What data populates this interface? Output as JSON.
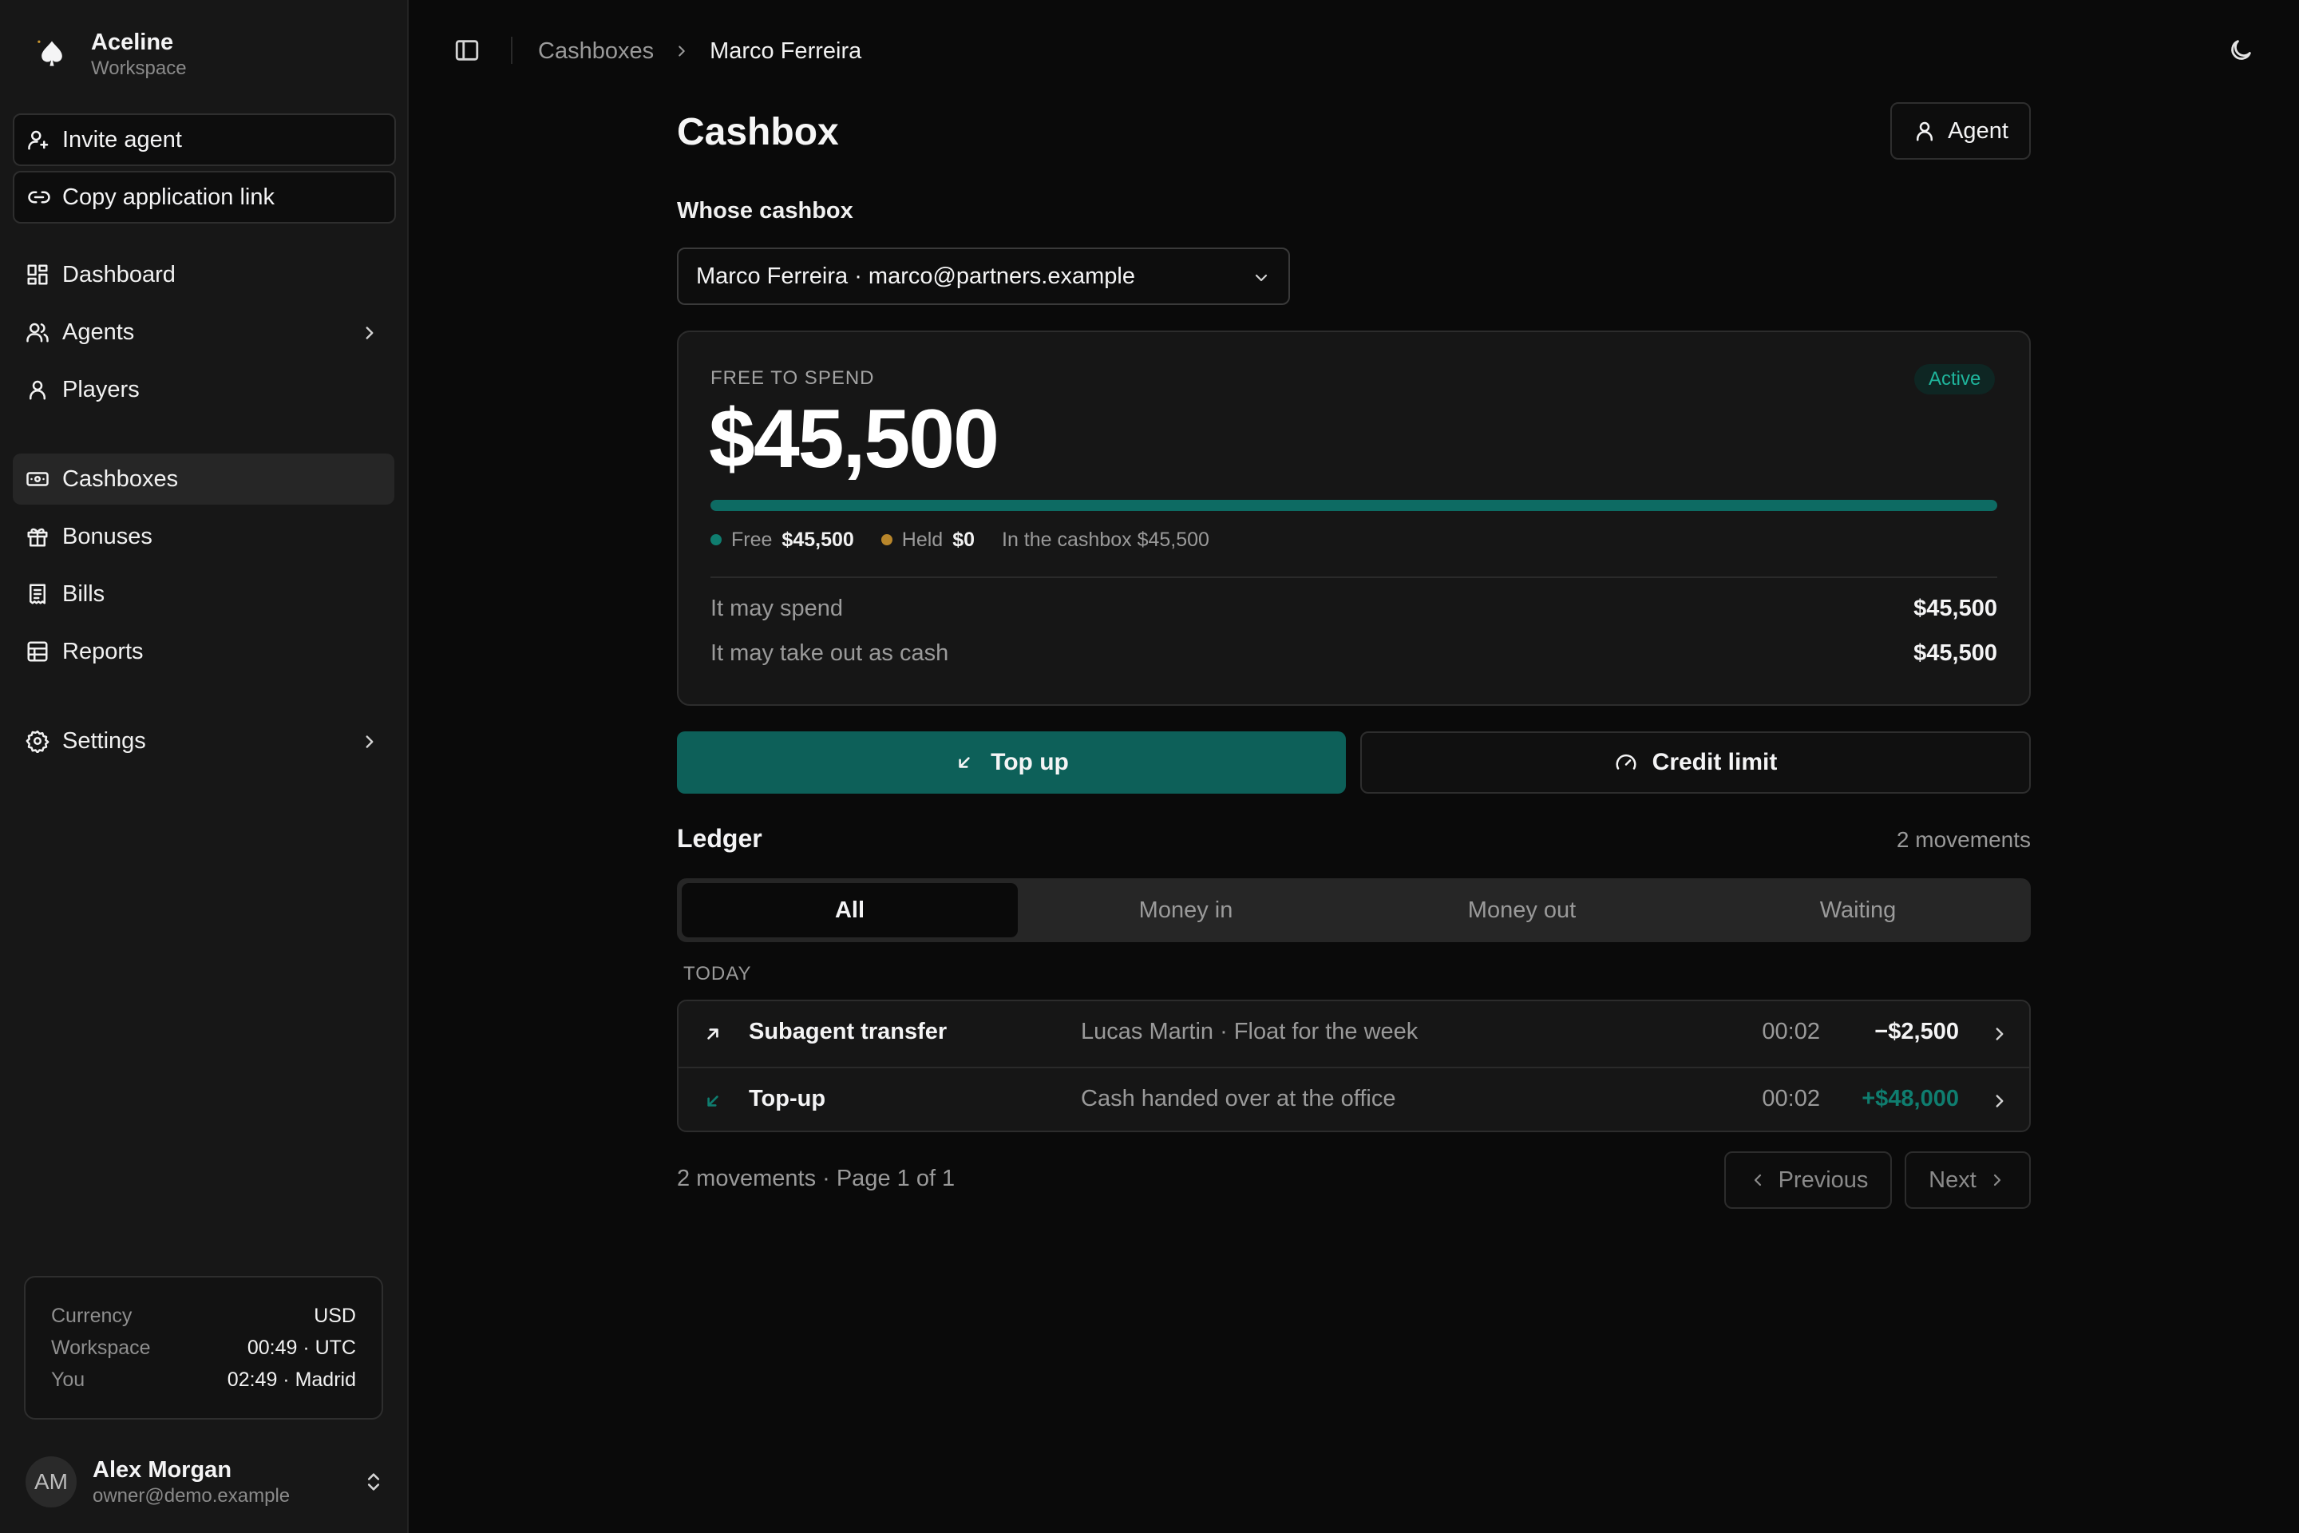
{
  "brand": {
    "name": "Aceline",
    "subtitle": "Workspace"
  },
  "sidebar": {
    "actions": [
      {
        "label": "Invite agent",
        "icon": "user-plus-icon"
      },
      {
        "label": "Copy application link",
        "icon": "link-icon"
      }
    ],
    "nav": [
      {
        "label": "Dashboard",
        "icon": "dashboard-icon",
        "chevron": false,
        "active": false
      },
      {
        "label": "Agents",
        "icon": "users-icon",
        "chevron": true,
        "active": false
      },
      {
        "label": "Players",
        "icon": "user-icon",
        "chevron": false,
        "active": false
      },
      {
        "label": "Cashboxes",
        "icon": "banknote-icon",
        "chevron": false,
        "active": true
      },
      {
        "label": "Bonuses",
        "icon": "gift-icon",
        "chevron": false,
        "active": false
      },
      {
        "label": "Bills",
        "icon": "receipt-icon",
        "chevron": false,
        "active": false
      },
      {
        "label": "Reports",
        "icon": "table-icon",
        "chevron": false,
        "active": false
      },
      {
        "label": "Settings",
        "icon": "gear-icon",
        "chevron": true,
        "active": false
      }
    ],
    "info": {
      "currency_label": "Currency",
      "currency_value": "USD",
      "workspace_label": "Workspace",
      "workspace_value": "00:49 · UTC",
      "you_label": "You",
      "you_value": "02:49 · Madrid"
    },
    "user": {
      "initials": "AM",
      "name": "Alex Morgan",
      "email": "owner@demo.example"
    }
  },
  "breadcrumb": {
    "parent": "Cashboxes",
    "current": "Marco Ferreira"
  },
  "page": {
    "title": "Cashbox",
    "agent_button": "Agent",
    "whose_label": "Whose cashbox",
    "whose_value": "Marco Ferreira · marco@partners.example"
  },
  "balance": {
    "label": "FREE TO SPEND",
    "status": "Active",
    "amount": "$45,500",
    "free_fraction": 1.0,
    "legend": {
      "free_label": "Free",
      "free_value": "$45,500",
      "held_label": "Held",
      "held_value": "$0",
      "total": "In the cashbox $45,500"
    },
    "rows": [
      {
        "label": "It may spend",
        "value": "$45,500"
      },
      {
        "label": "It may take out as cash",
        "value": "$45,500"
      }
    ]
  },
  "buttons": {
    "top_up": "Top up",
    "credit_limit": "Credit limit"
  },
  "ledger": {
    "title": "Ledger",
    "count": "2 movements",
    "tabs": [
      "All",
      "Money in",
      "Money out",
      "Waiting"
    ],
    "active_tab": 0,
    "group": "TODAY",
    "rows": [
      {
        "type": "Subagent transfer",
        "description": "Lucas Martin · Float for the week",
        "time": "00:02",
        "amount": "−$2,500",
        "direction": "out"
      },
      {
        "type": "Top-up",
        "description": "Cash handed over at the office",
        "time": "00:02",
        "amount": "+$48,000",
        "direction": "in"
      }
    ],
    "pager_info": "2 movements · Page 1 of 1",
    "previous": "Previous",
    "next": "Next"
  },
  "colors": {
    "accent": "#0d6059",
    "accent_bar": "#0d6b63",
    "positive": "#0f7d6f",
    "status_text": "#1fb59c",
    "free_dot": "#0f7d6f",
    "held_dot": "#b8862b"
  }
}
